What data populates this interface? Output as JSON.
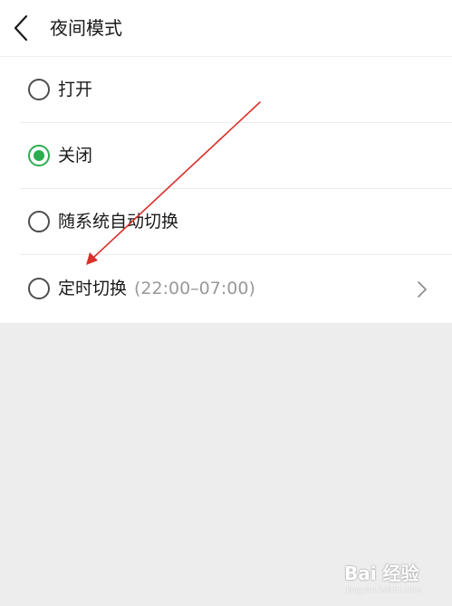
{
  "header": {
    "back_icon": "chevron-left-icon",
    "title": "夜间模式"
  },
  "options": [
    {
      "label": "打开",
      "detail": "",
      "selected": false
    },
    {
      "label": "关闭",
      "detail": "",
      "selected": true
    },
    {
      "label": "随系统自动切换",
      "detail": "",
      "selected": false
    },
    {
      "label": "定时切换",
      "detail": "(22:00–07:00)",
      "selected": false,
      "has_chevron": true
    }
  ],
  "colors": {
    "accent": "#2bae4e",
    "annotation_arrow": "#d9302a",
    "background": "#ededed"
  },
  "watermark": {
    "main": "Bai 经验",
    "sub": "jingyan.baidu.com"
  }
}
